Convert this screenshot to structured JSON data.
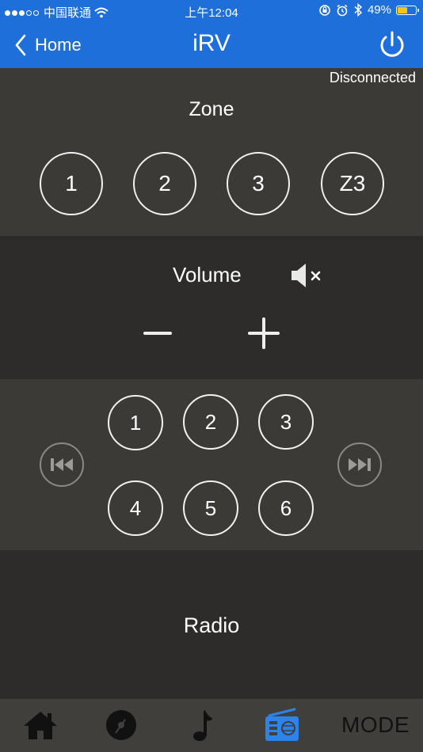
{
  "status_bar": {
    "carrier": "中国联通",
    "time": "上午12:04",
    "battery_percent_label": "49%",
    "battery_level": 0.49
  },
  "nav": {
    "back_label": "Home",
    "title": "iRV"
  },
  "connection_status": "Disconnected",
  "zone": {
    "title": "Zone",
    "buttons": [
      "1",
      "2",
      "3",
      "Z3"
    ]
  },
  "volume": {
    "title": "Volume"
  },
  "presets": [
    "1",
    "2",
    "3",
    "4",
    "5",
    "6"
  ],
  "source_label": "Radio",
  "tabs": {
    "mode_label": "MODE"
  },
  "colors": {
    "accent": "#1e6fd9",
    "battery": "#f4c61c"
  }
}
